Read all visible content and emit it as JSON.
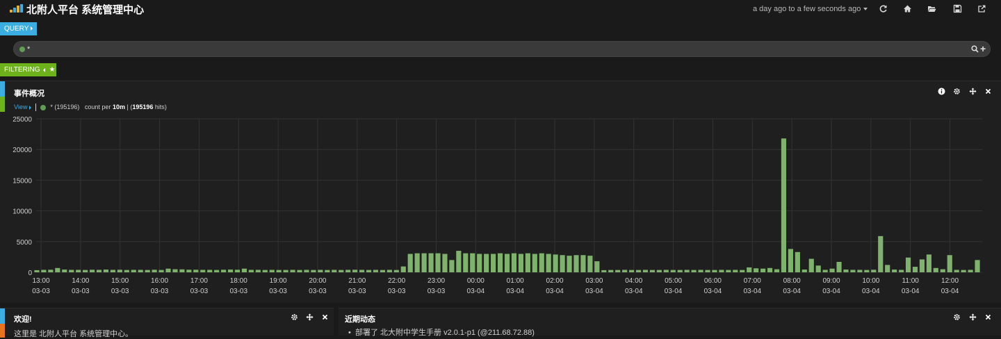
{
  "header": {
    "title": "北附人平台 系统管理中心",
    "timerange": "a day ago to a few seconds ago",
    "icons": [
      "refresh-icon",
      "home-icon",
      "folder-open-icon",
      "save-icon",
      "share-icon"
    ]
  },
  "query": {
    "tab_label": "QUERY",
    "value": "*",
    "dot_color": "#629e51"
  },
  "filtering": {
    "tab_label": "FILTERING"
  },
  "colors": {
    "query_tab": "#3aaee0",
    "filter_tab": "#6eb21b",
    "bar": "#7eb26d",
    "background": "#1a1a1a"
  },
  "histogram_panel": {
    "title": "事件概况",
    "legend": {
      "view_label": "View",
      "series_text": "* (195196)",
      "count_prefix": "count per",
      "interval": "10m",
      "hits_open": "(",
      "hits": "195196",
      "hits_suffix": "hits)"
    }
  },
  "welcome_panel": {
    "title": "欢迎!",
    "text": "这里是 北附人平台 系统管理中心。"
  },
  "recent_panel": {
    "title": "近期动态",
    "items": [
      "部署了 北大附中学生手册 v2.0.1-p1 (@211.68.72.88)"
    ]
  },
  "chart_data": {
    "type": "bar",
    "y_ticks": [
      "25000",
      "20000",
      "15000",
      "10000",
      "5000",
      "0"
    ],
    "ylim": [
      0,
      25000
    ],
    "grid": true,
    "series": [
      {
        "name": "*",
        "color": "#7eb26d"
      }
    ],
    "x_ticks": [
      {
        "time": "13:00",
        "date": "03-03"
      },
      {
        "time": "14:00",
        "date": "03-03"
      },
      {
        "time": "15:00",
        "date": "03-03"
      },
      {
        "time": "16:00",
        "date": "03-03"
      },
      {
        "time": "17:00",
        "date": "03-03"
      },
      {
        "time": "18:00",
        "date": "03-03"
      },
      {
        "time": "19:00",
        "date": "03-03"
      },
      {
        "time": "20:00",
        "date": "03-03"
      },
      {
        "time": "21:00",
        "date": "03-03"
      },
      {
        "time": "22:00",
        "date": "03-03"
      },
      {
        "time": "23:00",
        "date": "03-03"
      },
      {
        "time": "00:00",
        "date": "03-04"
      },
      {
        "time": "01:00",
        "date": "03-04"
      },
      {
        "time": "02:00",
        "date": "03-04"
      },
      {
        "time": "03:00",
        "date": "03-04"
      },
      {
        "time": "04:00",
        "date": "03-04"
      },
      {
        "time": "05:00",
        "date": "03-04"
      },
      {
        "time": "06:00",
        "date": "03-04"
      },
      {
        "time": "07:00",
        "date": "03-04"
      },
      {
        "time": "08:00",
        "date": "03-04"
      },
      {
        "time": "09:00",
        "date": "03-04"
      },
      {
        "time": "10:00",
        "date": "03-04"
      },
      {
        "time": "11:00",
        "date": "03-04"
      },
      {
        "time": "12:00",
        "date": "03-04"
      }
    ],
    "values": [
      350,
      400,
      420,
      700,
      450,
      400,
      400,
      380,
      420,
      400,
      450,
      400,
      420,
      380,
      400,
      400,
      380,
      420,
      380,
      600,
      500,
      480,
      420,
      420,
      400,
      400,
      380,
      420,
      450,
      420,
      600,
      400,
      400,
      380,
      400,
      380,
      380,
      400,
      380,
      400,
      380,
      400,
      380,
      400,
      380,
      400,
      420,
      400,
      380,
      400,
      380,
      400,
      380,
      950,
      3000,
      3100,
      3100,
      3100,
      3100,
      3000,
      2000,
      3500,
      3100,
      3100,
      3000,
      3000,
      3000,
      3100,
      3000,
      3100,
      3000,
      3100,
      3000,
      3100,
      3000,
      2900,
      2800,
      2700,
      2800,
      2800,
      2700,
      1800,
      350,
      380,
      380,
      400,
      380,
      380,
      400,
      380,
      380,
      400,
      380,
      380,
      400,
      380,
      400,
      380,
      380,
      400,
      380,
      400,
      380,
      800,
      650,
      600,
      700,
      500,
      21800,
      3800,
      3300,
      450,
      2200,
      1100,
      400,
      600,
      1700,
      450,
      400,
      400,
      380,
      420,
      5900,
      1200,
      450,
      400,
      2400,
      900,
      2100,
      2900,
      700,
      500,
      2800,
      400,
      380,
      400,
      2000
    ]
  }
}
